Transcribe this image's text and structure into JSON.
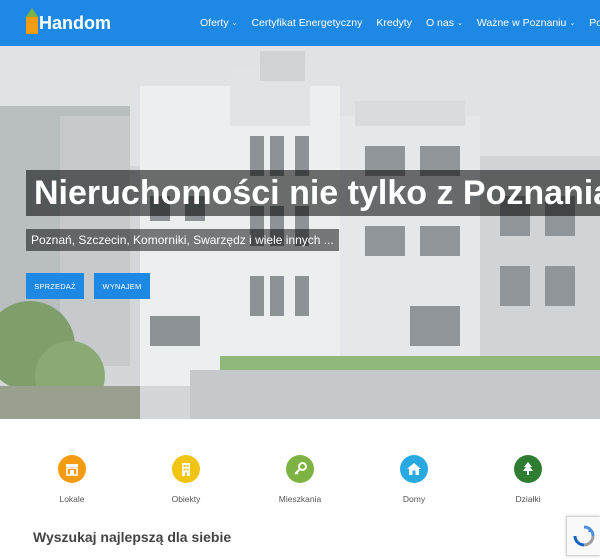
{
  "brand": {
    "name": "Handom",
    "colors": {
      "primary": "#1e88e5",
      "logo_roof": "#7cb342",
      "logo_body": "#f39c12"
    }
  },
  "nav": {
    "items": [
      {
        "label": "Oferty",
        "has_dropdown": true
      },
      {
        "label": "Certyfikat Energetyczny",
        "has_dropdown": false
      },
      {
        "label": "Kredyty",
        "has_dropdown": false
      },
      {
        "label": "O nas",
        "has_dropdown": true
      },
      {
        "label": "Ważne w Poznaniu",
        "has_dropdown": true
      },
      {
        "label": "Power",
        "has_dropdown": false
      }
    ],
    "chevron": "⌄"
  },
  "hero": {
    "title": "Nieruchomości nie tylko z Poznania!",
    "subtitle": "Poznań, Szczecin, Komorniki, Swarzędz i wiele innych ...",
    "buttons": {
      "sell": "SPRZEDAŻ",
      "rent": "WYNAJEM"
    }
  },
  "categories": [
    {
      "label": "Lokale",
      "icon": "shop-icon",
      "color": "#f39c12"
    },
    {
      "label": "Obiekty",
      "icon": "building-icon",
      "color": "#f1c40f"
    },
    {
      "label": "Mieszkania",
      "icon": "key-icon",
      "color": "#7cb342"
    },
    {
      "label": "Domy",
      "icon": "house-icon",
      "color": "#29a9e1"
    },
    {
      "label": "Działki",
      "icon": "tree-icon",
      "color": "#2e7d32"
    }
  ],
  "cta": {
    "text": "Wyszukaj najlepszą dla siebie"
  },
  "recaptcha": {
    "icon": "recaptcha-icon"
  }
}
